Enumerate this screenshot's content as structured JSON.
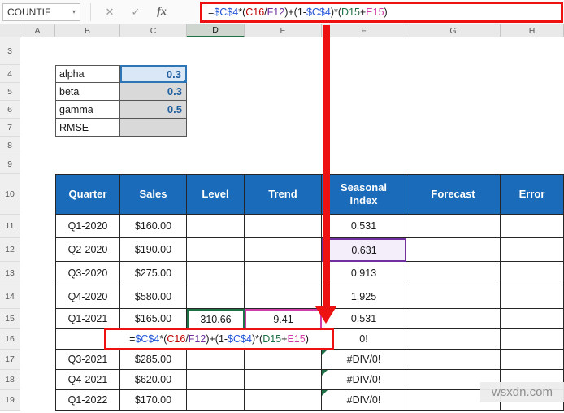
{
  "app": {
    "watermark": "wsxdn.com"
  },
  "colors": {
    "table_header_blue": "#1a6cba",
    "value_blue": "#1f5fa0",
    "annotation_red": "#ee1111",
    "selection_blue": "#2e75b6",
    "ref_purple": "#7030a0",
    "ref_green": "#1e7145",
    "ref_pink": "#d23ca8",
    "error_green": "#1e7145",
    "param_gray": "#d9d9d9"
  },
  "formula_bar": {
    "name_box_value": "COUNTIF",
    "dropdown_icon": "▾",
    "cancel_icon": "✕",
    "enter_icon": "✓",
    "fx_icon": "fx",
    "formula_text": "=$C$4*(C16/F12)+(1-$C$4)*(D15+E15)",
    "segments": [
      {
        "t": "=",
        "c": "#1a1a1a"
      },
      {
        "t": "$C$4",
        "c": "#2456d6"
      },
      {
        "t": "*(",
        "c": "#1a1a1a"
      },
      {
        "t": "C16",
        "c": "#c00000"
      },
      {
        "t": "/",
        "c": "#1a1a1a"
      },
      {
        "t": "F12",
        "c": "#7030a0"
      },
      {
        "t": ")+(1-",
        "c": "#1a1a1a"
      },
      {
        "t": "$C$4",
        "c": "#2456d6"
      },
      {
        "t": ")*(",
        "c": "#1a1a1a"
      },
      {
        "t": "D15",
        "c": "#1e7145"
      },
      {
        "t": "+",
        "c": "#1a1a1a"
      },
      {
        "t": "E15",
        "c": "#d23ca8"
      },
      {
        "t": ")",
        "c": "#1a1a1a"
      }
    ]
  },
  "grid": {
    "column_headers": [
      "A",
      "B",
      "C",
      "D",
      "E",
      "F",
      "G",
      "H"
    ],
    "row_numbers": [
      "3",
      "4",
      "5",
      "6",
      "7",
      "8",
      "9",
      "10",
      "11",
      "12",
      "13",
      "14",
      "15",
      "16",
      "17",
      "18",
      "19"
    ]
  },
  "params": {
    "rows": [
      {
        "label": "alpha",
        "value": "0.3"
      },
      {
        "label": "beta",
        "value": "0.3"
      },
      {
        "label": "gamma",
        "value": "0.5"
      },
      {
        "label": "RMSE",
        "value": ""
      }
    ]
  },
  "table": {
    "headers": [
      "Quarter",
      "Sales",
      "Level",
      "Trend",
      "Seasonal Index",
      "Forecast",
      "Error"
    ],
    "rows": [
      {
        "quarter": "Q1-2020",
        "sales": "$160.00",
        "level": "",
        "trend": "",
        "seasonal": "0.531",
        "forecast": "",
        "error": ""
      },
      {
        "quarter": "Q2-2020",
        "sales": "$190.00",
        "level": "",
        "trend": "",
        "seasonal": "0.631",
        "forecast": "",
        "error": ""
      },
      {
        "quarter": "Q3-2020",
        "sales": "$275.00",
        "level": "",
        "trend": "",
        "seasonal": "0.913",
        "forecast": "",
        "error": ""
      },
      {
        "quarter": "Q4-2020",
        "sales": "$580.00",
        "level": "",
        "trend": "",
        "seasonal": "1.925",
        "forecast": "",
        "error": ""
      },
      {
        "quarter": "Q1-2021",
        "sales": "$165.00",
        "level": "310.66",
        "trend": "9.41",
        "seasonal": "0.531",
        "forecast": "",
        "error": ""
      },
      {
        "quarter": "Q3-2021",
        "sales": "$285.00",
        "level": "",
        "trend": "",
        "seasonal": "#DIV/0!",
        "forecast": "",
        "error": ""
      },
      {
        "quarter": "Q4-2021",
        "sales": "$620.00",
        "level": "",
        "trend": "",
        "seasonal": "#DIV/0!",
        "forecast": "",
        "error": ""
      },
      {
        "quarter": "Q1-2022",
        "sales": "$170.00",
        "level": "",
        "trend": "",
        "seasonal": "#DIV/0!",
        "forecast": "",
        "error": ""
      }
    ],
    "formula_row": {
      "seasonal_partial": "0!"
    }
  }
}
